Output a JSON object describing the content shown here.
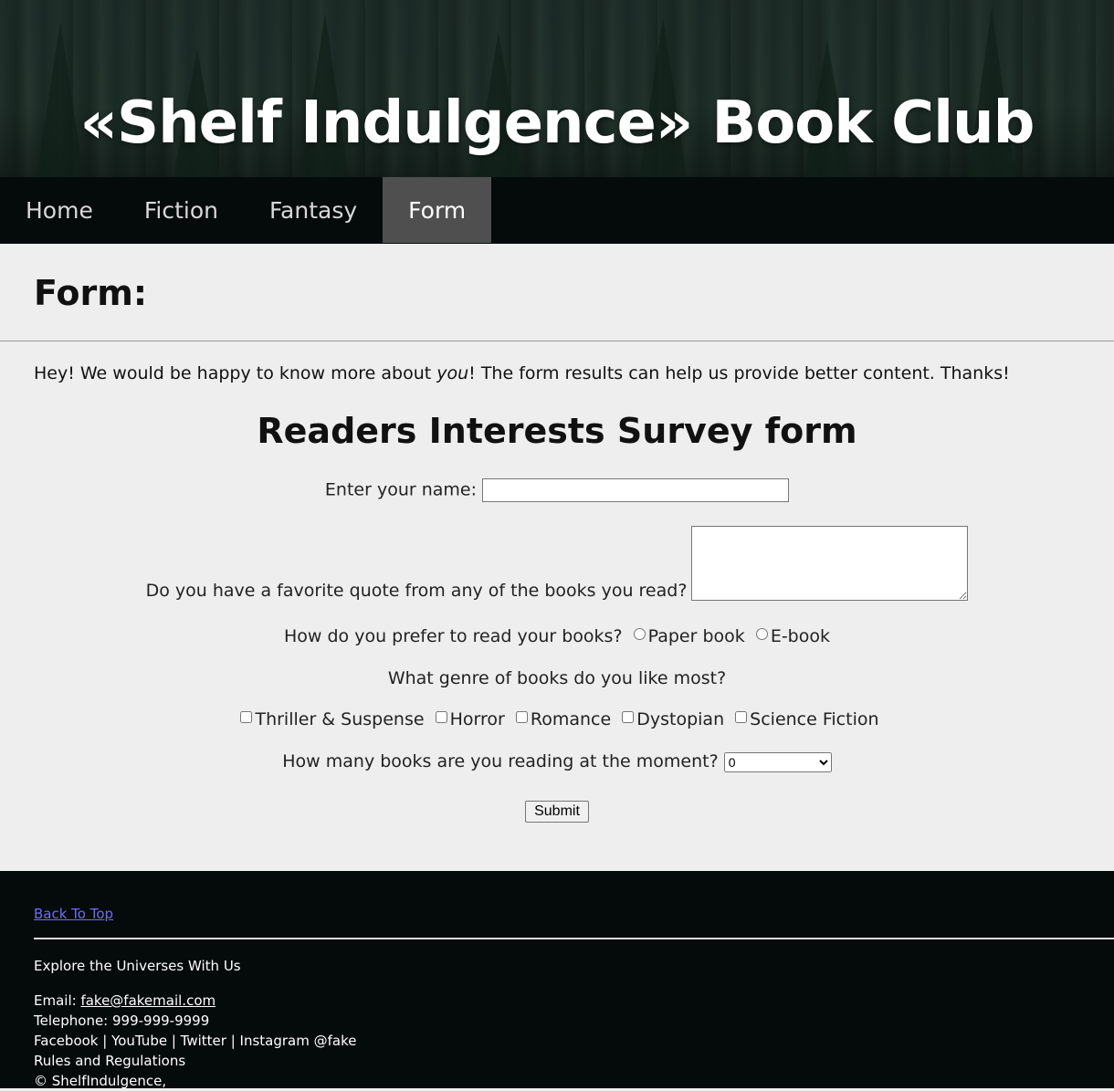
{
  "header": {
    "title": "«Shelf Indulgence» Book Club"
  },
  "nav": {
    "items": [
      {
        "label": "Home"
      },
      {
        "label": "Fiction"
      },
      {
        "label": "Fantasy"
      },
      {
        "label": "Form"
      }
    ],
    "active": "Form"
  },
  "main": {
    "page_title": "Form:",
    "intro_before": "Hey! We would be happy to know more about ",
    "intro_em": "you",
    "intro_after": "! The form results can help us provide better content. Thanks!",
    "form_title": "Readers Interests Survey form",
    "name_label": "Enter your name:",
    "name_value": "",
    "quote_label": "Do you have a favorite quote from any of the books you read?",
    "quote_value": "",
    "read_label": "How do you prefer to read your books?",
    "read_options": [
      "Paper book",
      "E-book"
    ],
    "genre_label": "What genre of books do you like most?",
    "genres": [
      "Thriller & Suspense",
      "Horror",
      "Romance",
      "Dystopian",
      "Science Fiction"
    ],
    "count_label": "How many books are you reading at the moment?",
    "count_selected": "0",
    "submit_label": "Submit"
  },
  "footer": {
    "back_to_top": "Back To Top",
    "tagline": "Explore the Universes With Us",
    "email_label": "Email: ",
    "email": "fake@fakemail.com",
    "telephone": "Telephone: 999-999-9999",
    "social": "Facebook | YouTube | Twitter | Instagram @fake",
    "rules": "Rules and Regulations",
    "copyright": "© ShelfIndulgence,"
  },
  "colors": {
    "nav_bg": "#050a0a",
    "nav_active": "#4f4f4f",
    "page_bg": "#eeeeee",
    "link": "#6f6cff"
  }
}
